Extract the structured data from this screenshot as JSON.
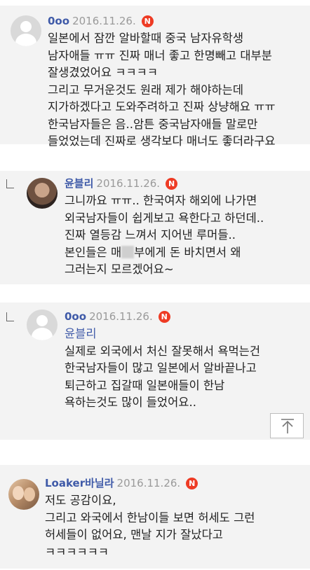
{
  "comments": [
    {
      "user": "0oo",
      "date": "2016.11.26.",
      "badge": "N",
      "lines": [
        "일본에서 잠깐 알바할때 중국 남자유학생",
        "남자애들 ㅠㅠ 진짜 매너 좋고 한명빼고 대부분",
        "잘생겼었어요 ㅋㅋㅋㅋ",
        "그리고 무거운것도 원래 제가 해야하는데",
        "지가하겠다고 도와주려하고 진짜 상냥해요 ㅠㅠ",
        "한국남자들은 음..암튼 중국남자애들 말로만",
        "들었었는데 진짜로 생각보다 매너도 좋더라구요"
      ]
    },
    {
      "user": "윤블리",
      "date": "2016.11.26.",
      "badge": "N",
      "lines": [
        "그니까요 ㅠㅠ.. 한국여자 해외에 나가면",
        "외국남자들이 쉽게보고 욕한다고 하던데..",
        "진짜 열등감 느껴서 지어낸 루머들..",
        "본인들은 매",
        "부에게 돈 바치면서 왜",
        "그러는지 모르겠어요~"
      ]
    },
    {
      "user": "0oo",
      "date": "2016.11.26.",
      "badge": "N",
      "mention": "윤블리",
      "lines": [
        "실제로 외국에서 처신 잘못해서 욕먹는건",
        "한국남자들이 많고 일본에서 알바끝나고",
        "퇴근하고 집갈때 일본애들이 한남",
        "욕하는것도 많이 들었어요.."
      ]
    },
    {
      "user": "Loaker바닐라",
      "date": "2016.11.26.",
      "badge": "N",
      "lines": [
        "저도 공감이요,",
        "그리고 와국에서 한남이들 보면 허세도 그런",
        "허세들이 없어요, 맨날 지가 잘났다고",
        "ㅋㅋㅋㅋㅋㅋ"
      ]
    }
  ],
  "colors": {
    "username": "#3f5aa8",
    "date": "#9a9a9a",
    "badge": "#ee3b24",
    "card": "#f3f3f3"
  },
  "icons": {
    "scroll_top": "arrow-up-to-line-icon",
    "reply": "reply-corner-icon"
  }
}
